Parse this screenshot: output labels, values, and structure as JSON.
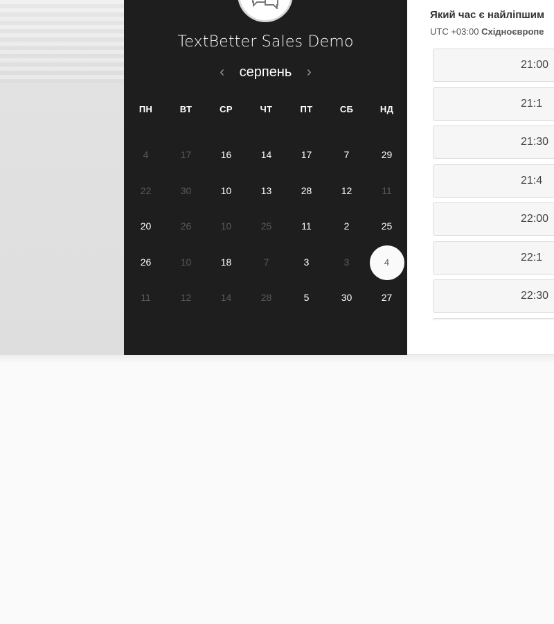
{
  "event": {
    "title": "TextBetter Sales Demo"
  },
  "calendar": {
    "month": "серпень",
    "prev_icon": "‹",
    "next_icon": "›",
    "weekdays": [
      "ПН",
      "ВТ",
      "СР",
      "ЧТ",
      "ПТ",
      "СБ",
      "НД"
    ],
    "weeks": [
      [
        {
          "d": "4",
          "a": false
        },
        {
          "d": "17",
          "a": false
        },
        {
          "d": "16",
          "a": true
        },
        {
          "d": "14",
          "a": true
        },
        {
          "d": "17",
          "a": true
        },
        {
          "d": "7",
          "a": true
        },
        {
          "d": "29",
          "a": true
        }
      ],
      [
        {
          "d": "22",
          "a": false
        },
        {
          "d": "30",
          "a": false
        },
        {
          "d": "10",
          "a": true
        },
        {
          "d": "13",
          "a": true
        },
        {
          "d": "28",
          "a": true
        },
        {
          "d": "12",
          "a": true
        },
        {
          "d": "11",
          "a": false
        }
      ],
      [
        {
          "d": "20",
          "a": true
        },
        {
          "d": "26",
          "a": false
        },
        {
          "d": "10",
          "a": false
        },
        {
          "d": "25",
          "a": false
        },
        {
          "d": "11",
          "a": true
        },
        {
          "d": "2",
          "a": true
        },
        {
          "d": "25",
          "a": true
        }
      ],
      [
        {
          "d": "26",
          "a": true
        },
        {
          "d": "10",
          "a": false
        },
        {
          "d": "18",
          "a": true
        },
        {
          "d": "7",
          "a": false
        },
        {
          "d": "3",
          "a": true
        },
        {
          "d": "3",
          "a": false
        },
        {
          "d": "4",
          "a": true,
          "sel": true
        }
      ],
      [
        {
          "d": "11",
          "a": false
        },
        {
          "d": "12",
          "a": false
        },
        {
          "d": "14",
          "a": false
        },
        {
          "d": "28",
          "a": false
        },
        {
          "d": "5",
          "a": true
        },
        {
          "d": "30",
          "a": true
        },
        {
          "d": "27",
          "a": true
        }
      ]
    ]
  },
  "time_panel": {
    "question": "Який час є найліпшим",
    "tz_offset": "UTC +03:00",
    "tz_name": "Східноєвропе",
    "slots": [
      "21:00",
      "21:1",
      "21:30",
      "21:4",
      "22:00",
      "22:1",
      "22:30",
      ""
    ]
  }
}
